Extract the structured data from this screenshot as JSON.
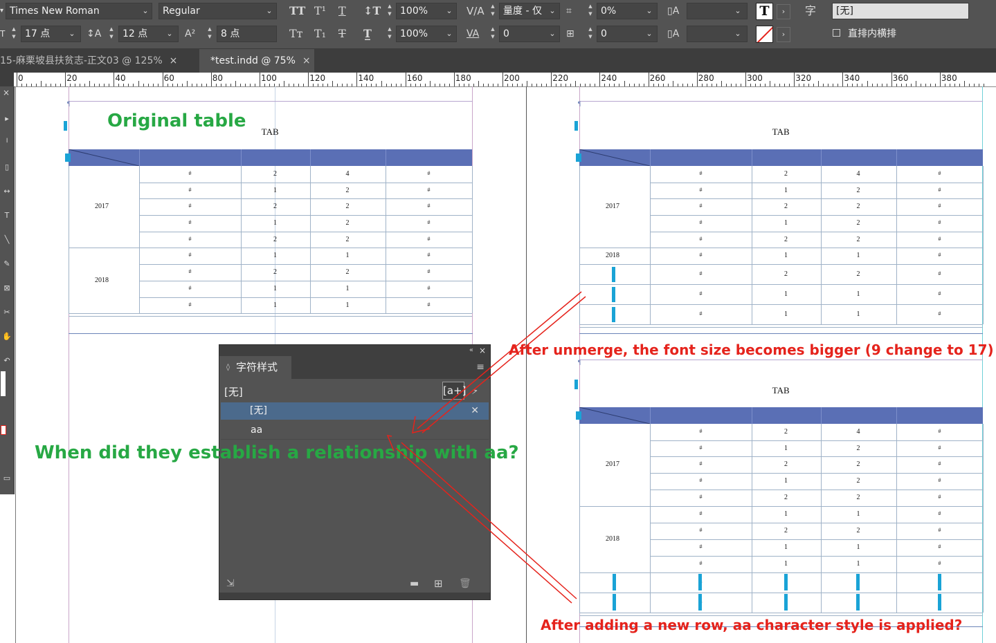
{
  "control_bar": {
    "font_family": "Times New Roman",
    "font_style": "Regular",
    "font_size": "17 点",
    "leading": "12 点",
    "baseline_shift": "8 点",
    "vertical_scale": "100%",
    "horizontal_scale": "100%",
    "kerning": "量度 - 仅",
    "tracking": "0",
    "skew": "0%",
    "tsume": "0",
    "char_style": "[无]",
    "vertical_in_horizontal_label": "直排内横排"
  },
  "tabs": [
    {
      "label": "15-麻栗坡县扶贫志-正文03 @ 125%",
      "close": "×"
    },
    {
      "label": "*test.indd @ 75%",
      "close": "×"
    }
  ],
  "ruler": {
    "labels": [
      "0",
      "20",
      "40",
      "60",
      "80",
      "100",
      "120",
      "140",
      "160",
      "180",
      "200",
      "220",
      "240",
      "260",
      "280",
      "300",
      "320",
      "340",
      "360",
      "380"
    ]
  },
  "tables": [
    {
      "caption": "TAB",
      "year_labels": [
        "2017",
        "2018"
      ],
      "col2": [
        "2",
        "1",
        "2",
        "1",
        "2",
        "1",
        "2",
        "1",
        "1"
      ],
      "col4": [
        "4",
        "2",
        "2",
        "2",
        "2",
        "1",
        "2",
        "1",
        "1"
      ]
    }
  ],
  "annotations": {
    "original": "Original table",
    "question": "When did they establish a relationship with aa?",
    "unmerge": "After unmerge, the font size becomes bigger (9 change to 17)",
    "new_row": "After adding a new row, aa character style is applied?"
  },
  "panel": {
    "title": "字符样式",
    "current": "[无]",
    "items": [
      "[无]",
      "aa"
    ]
  },
  "colors": {
    "annotation_green": "#27a844",
    "annotation_red": "#e5231c",
    "table_header": "#5a6fb5",
    "char_marker": "#1aa3d6"
  }
}
